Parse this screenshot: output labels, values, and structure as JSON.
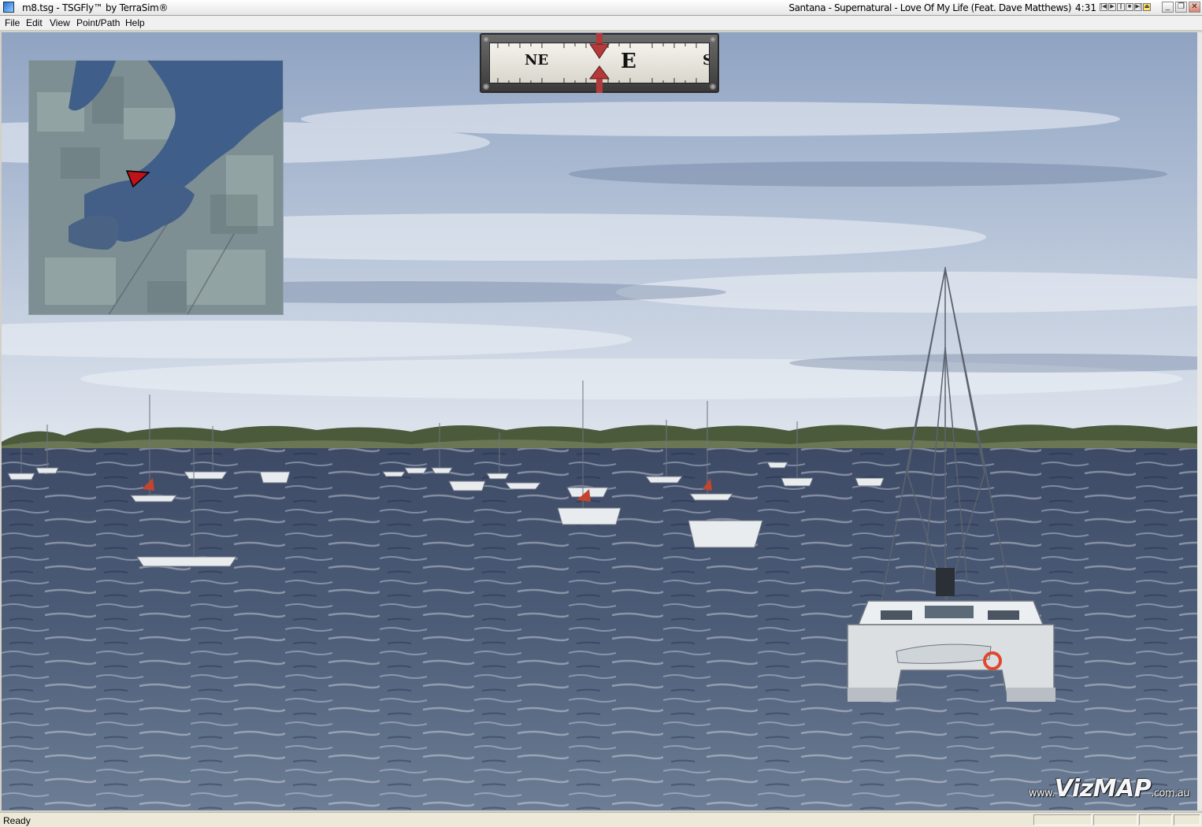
{
  "window": {
    "title": "m8.tsg - TSGFly™ by TerraSim®",
    "now_playing": "Santana - Supernatural - Love Of My Life (Feat. Dave Matthews)",
    "track_time": "4:31",
    "media_controls": [
      "prev-icon",
      "play-icon",
      "pause-icon",
      "stop-icon",
      "next-icon",
      "eject-icon"
    ],
    "controls": {
      "minimize": "_",
      "restore": "❐",
      "close": "✕"
    }
  },
  "menu": {
    "items": [
      {
        "label": "File"
      },
      {
        "label": "Edit"
      },
      {
        "label": "View"
      },
      {
        "label": "Point/Path"
      },
      {
        "label": "Help"
      }
    ]
  },
  "compass": {
    "labels": [
      "NE",
      "E",
      "S"
    ],
    "heading": "E",
    "colors": {
      "needle": "#b23a3a",
      "frame": "#4a4a4a",
      "face": "#ebe8e0"
    }
  },
  "minimap": {
    "marker": "position-arrow-icon",
    "colors": {
      "water": "#3f5f8a",
      "land": "#7d8f92",
      "marker": "#c0121a"
    }
  },
  "watermark": {
    "prefix": "www.",
    "brand": "VizMAP",
    "suffix": ".com.au"
  },
  "status": {
    "text": "Ready"
  }
}
